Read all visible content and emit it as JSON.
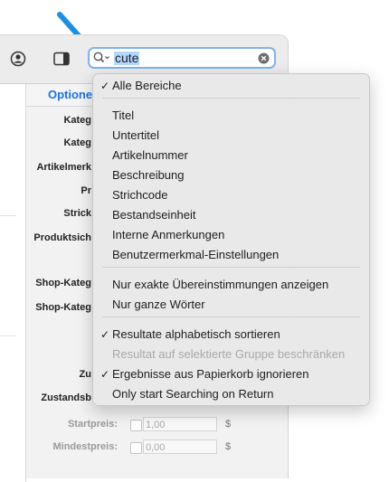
{
  "search": {
    "value": "cute"
  },
  "form": {
    "header_tab": "Optionen",
    "labels": [
      "Kateg",
      "Kateg",
      "Artikelmerk",
      "Pr",
      "Strick",
      "Produktsich",
      "Shop-Kateg",
      "Shop-Kateg",
      "Zu",
      "Zustandsb"
    ],
    "price_rows": [
      {
        "label": "Startpreis:",
        "value": "1,00",
        "unit": "$"
      },
      {
        "label": "Mindestpreis:",
        "value": "0,00",
        "unit": "$"
      }
    ]
  },
  "menu": {
    "items": [
      {
        "label": "Alle Bereiche",
        "checked": "✓",
        "disabled": false
      },
      {
        "label": "Titel",
        "checked": "",
        "disabled": false
      },
      {
        "label": "Untertitel",
        "checked": "",
        "disabled": false
      },
      {
        "label": "Artikelnummer",
        "checked": "",
        "disabled": false
      },
      {
        "label": "Beschreibung",
        "checked": "",
        "disabled": false
      },
      {
        "label": "Strichcode",
        "checked": "",
        "disabled": false
      },
      {
        "label": "Bestandseinheit",
        "checked": "",
        "disabled": false
      },
      {
        "label": "Interne Anmerkungen",
        "checked": "",
        "disabled": false
      },
      {
        "label": "Benutzermerkmal-Einstellungen",
        "checked": "",
        "disabled": false
      },
      {
        "label": "Nur exakte Übereinstimmungen anzeigen",
        "checked": "",
        "disabled": false
      },
      {
        "label": "Nur ganze Wörter",
        "checked": "",
        "disabled": false
      },
      {
        "label": "Resultate alphabetisch sortieren",
        "checked": "✓",
        "disabled": false
      },
      {
        "label": "Resultat auf selektierte Gruppe beschränken",
        "checked": "",
        "disabled": true
      },
      {
        "label": "Ergebnisse aus Papierkorb ignorieren",
        "checked": "✓",
        "disabled": false
      },
      {
        "label": "Only start Searching on Return",
        "checked": "",
        "disabled": false
      }
    ]
  },
  "colors": {
    "accent": "#1a73e8",
    "arrow": "#1a8fe3",
    "search_border": "#7fb2f0",
    "selection": "#b3d7ff"
  },
  "icons": [
    "arrow-annotation-icon",
    "user-circle-icon",
    "sidebar-toggle-icon",
    "search-icon",
    "chevron-down-icon",
    "clear-icon",
    "checkmark-icon"
  ]
}
